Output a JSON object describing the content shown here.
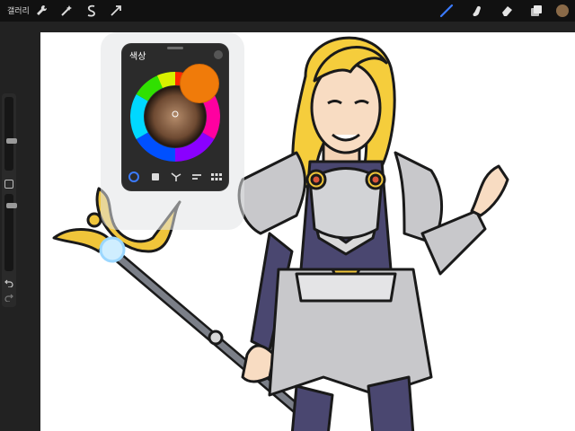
{
  "topbar": {
    "gallery_label": "갤러리",
    "left_tools": [
      "wrench-icon",
      "magic-wand-icon",
      "selection-icon",
      "transform-icon"
    ],
    "right_tools": [
      "brush-icon",
      "smudge-icon",
      "eraser-icon",
      "layers-icon"
    ],
    "active_color": "#8a6a48",
    "brush_active_color": "#3b7bff"
  },
  "color_panel": {
    "title": "색상",
    "current_color": "#f07b0a",
    "modes": [
      "disc",
      "classic",
      "harmony",
      "value",
      "palettes"
    ],
    "active_mode": "disc"
  }
}
